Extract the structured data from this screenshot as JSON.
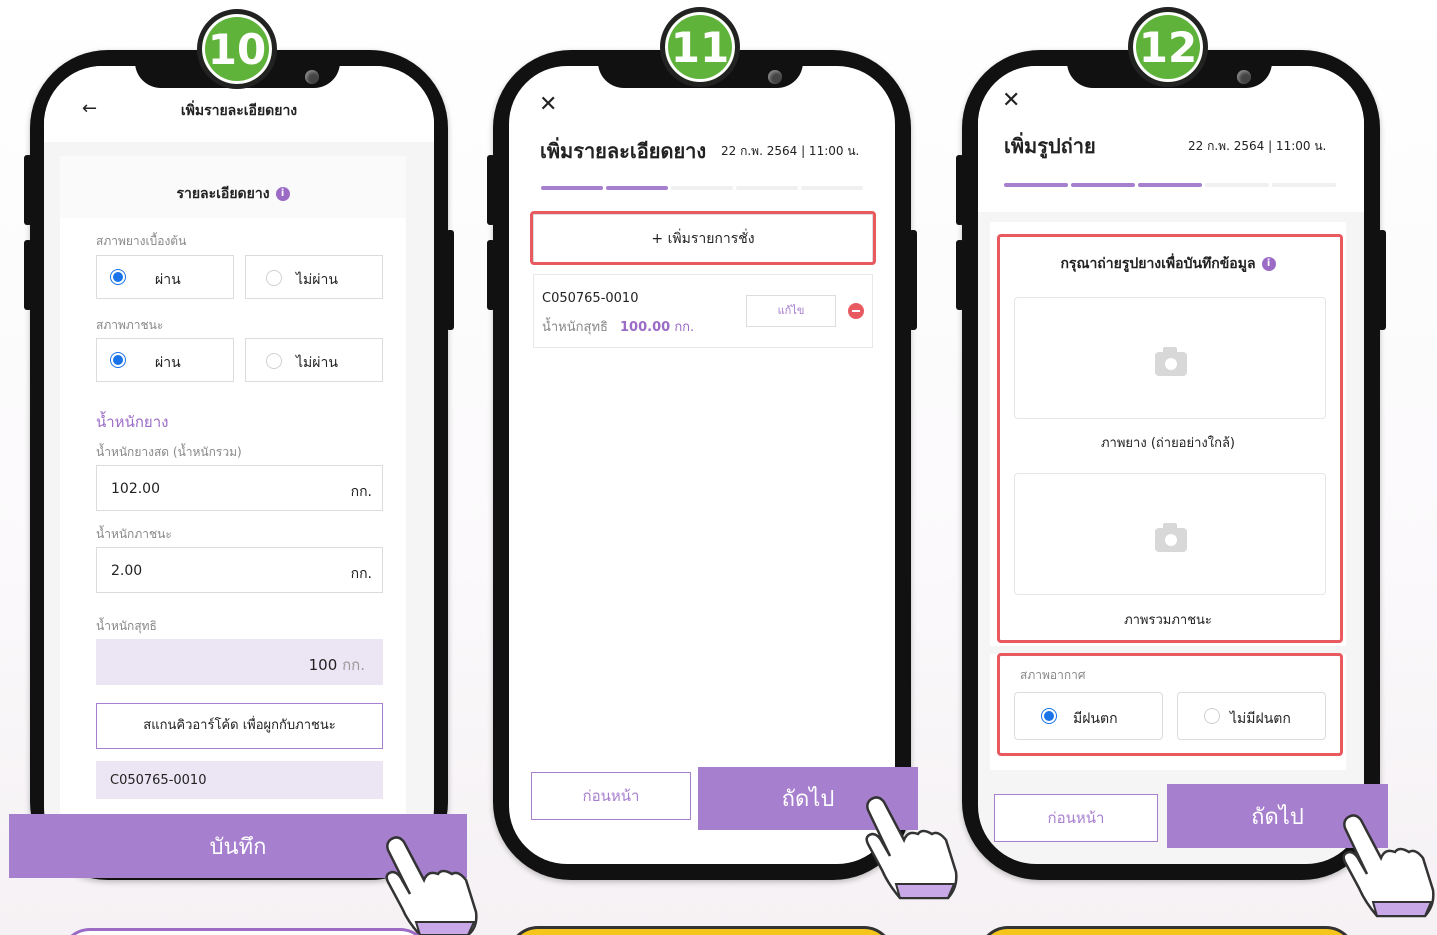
{
  "steps": [
    {
      "number": "10"
    },
    {
      "number": "11"
    },
    {
      "number": "12"
    }
  ],
  "screen10": {
    "title": "เพิ่มรายละเอียดยาง",
    "section_title": "รายละเอียดยาง",
    "rubber_condition_label": "สภาพยางเบื้องต้น",
    "container_condition_label": "สภาพภาชนะ",
    "pass_label": "ผ่าน",
    "fail_label": "ไม่ผ่าน",
    "weight_heading": "น้ำหนักยาง",
    "fresh_weight_label": "น้ำหนักยางสด (น้ำหนักรวม)",
    "fresh_weight_value": "102.00",
    "container_weight_label": "น้ำหนักภาชนะ",
    "container_weight_value": "2.00",
    "unit": "กก.",
    "net_weight_label": "น้ำหนักสุทธิ",
    "net_weight_value": "100",
    "scan_button": "สแกนคิวอาร์โค้ด เพื่อผูกกับภาชนะ",
    "container_code": "C050765-0010",
    "save_button": "บันทึก"
  },
  "screen11": {
    "title": "เพิ่มรายละเอียดยาง",
    "date": "22 ก.พ. 2564",
    "time": "| 11:00 น.",
    "progress": [
      true,
      true,
      false,
      false,
      false
    ],
    "add_weighing_button": "+ เพิ่มรายการชั่ง",
    "item_code": "C050765-0010",
    "item_net_label": "น้ำหนักสุทธิ",
    "item_net_value": "100.00",
    "item_unit": "กก.",
    "edit_button": "แก้ไข",
    "back_button": "ก่อนหน้า",
    "next_button": "ถัดไป"
  },
  "screen12": {
    "title": "เพิ่มรูปถ่าย",
    "date": "22 ก.พ. 2564",
    "time": "| 11:00 น.",
    "progress": [
      true,
      true,
      true,
      false,
      false
    ],
    "instruction": "กรุณาถ่ายรูปยางเพื่อบันทึกข้อมูล",
    "photo1_caption": "ภาพยาง (ถ่ายอย่างใกล้)",
    "photo2_caption": "ภาพรวมภาชนะ",
    "weather_label": "สภาพอากาศ",
    "rain_label": "มีฝนตก",
    "no_rain_label": "ไม่มีฝนตก",
    "back_button": "ก่อนหน้า",
    "next_button": "ถัดไป"
  },
  "colors": {
    "accent": "#a77fcf",
    "badge": "#5fb33a",
    "highlight": "#e85a5f",
    "radio": "#1a73e8"
  }
}
